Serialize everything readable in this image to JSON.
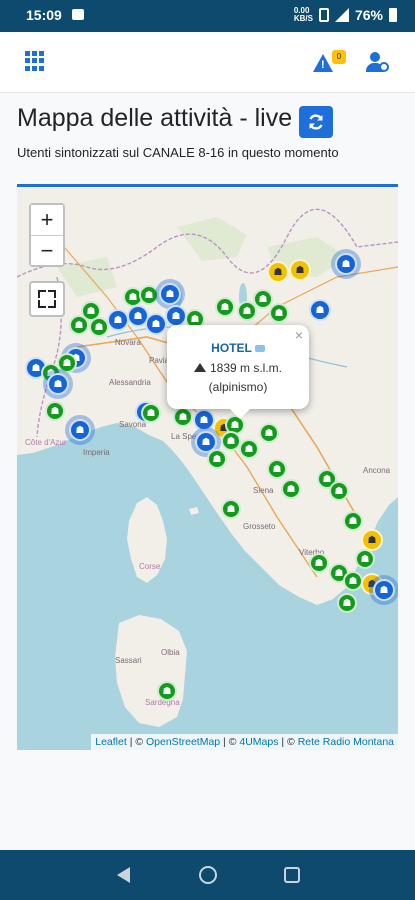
{
  "status_bar": {
    "time": "15:09",
    "battery": "76%",
    "net_top": "0.00",
    "net_bottom": "KB/S"
  },
  "header": {
    "title": "Mappa delle attività - live",
    "subtitle": "Utenti sintonizzati sul CANALE 8-16 in questo momento",
    "warning_badge": "0"
  },
  "map": {
    "zoom_in_label": "+",
    "zoom_out_label": "−",
    "popup": {
      "title": "HOTEL",
      "altitude": "1839 m s.l.m.",
      "activity": "(alpinismo)",
      "close": "×"
    },
    "attribution": {
      "leaflet": "Leaflet",
      "sep1": " | © ",
      "osm": "OpenStreetMap",
      "sep2": " | © ",
      "maps": "4UMaps",
      "sep3": " | © ",
      "rrm": "Rete Radio Montana"
    },
    "place_labels": [
      "Novara",
      "Pavia",
      "Alessandria",
      "Savona",
      "La Spezia",
      "Imperia",
      "Côte d'Azur",
      "Siena",
      "Grosseto",
      "Ancona",
      "Viterbo",
      "Sassari",
      "Olbia",
      "Sardegna",
      "Corse"
    ],
    "markers": {
      "green": 40,
      "blue": 18,
      "yellow": 5
    }
  },
  "colors": {
    "status_bar": "#0d4a6e",
    "accent": "#1e6fd9",
    "marker_green": "#139b1b",
    "marker_blue": "#1565d8",
    "marker_yellow": "#f2c100"
  },
  "icons": [
    "grid-icon",
    "warning-icon",
    "user-cog-icon",
    "refresh-icon",
    "fullscreen-icon",
    "mountain-icon",
    "chat-icon",
    "back-icon",
    "home-icon",
    "recents-icon"
  ]
}
